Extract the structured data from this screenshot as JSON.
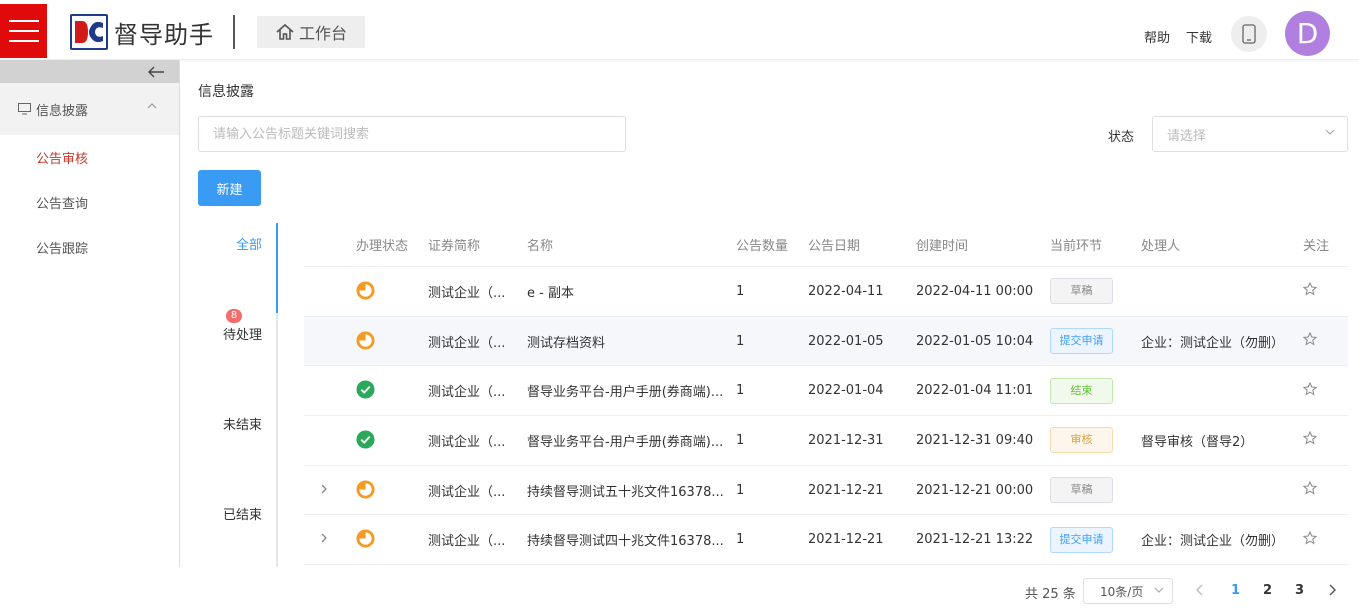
{
  "header": {
    "logo_mark": "DC",
    "logo_text": "督导助手",
    "workbench_label": "工作台",
    "help_label": "帮助",
    "download_label": "下载",
    "avatar_letter": "D",
    "brand_color": "#e10a0a",
    "avatar_color": "#b07fe0"
  },
  "sidebar": {
    "group_label": "信息披露",
    "items": [
      {
        "label": "公告审核",
        "active": true
      },
      {
        "label": "公告查询",
        "active": false
      },
      {
        "label": "公告跟踪",
        "active": false
      }
    ]
  },
  "main": {
    "title": "信息披露",
    "search_placeholder": "请输入公告标题关键词搜索",
    "status_label": "状态",
    "status_placeholder": "请选择",
    "new_button": "新建",
    "accent_color": "#3a9bf4"
  },
  "tabs": [
    {
      "label": "全部",
      "active": true
    },
    {
      "label": "待处理",
      "badge": "8"
    },
    {
      "label": "未结束"
    },
    {
      "label": "已结束"
    }
  ],
  "table": {
    "columns": [
      "办理状态",
      "证券简称",
      "名称",
      "公告数量",
      "公告日期",
      "创建时间",
      "当前环节",
      "处理人",
      "关注"
    ],
    "rows": [
      {
        "expand": false,
        "status_icon": "pending",
        "security": "测试企业（...",
        "name": "e - 副本",
        "count": "1",
        "pub_date": "2022-04-11",
        "created": "2022-04-11 00:00",
        "stage": "草稿",
        "stage_type": "draft",
        "handler": "",
        "highlight": false
      },
      {
        "expand": false,
        "status_icon": "pending",
        "security": "测试企业（...",
        "name": "测试存档资料",
        "count": "1",
        "pub_date": "2022-01-05",
        "created": "2022-01-05 10:04",
        "stage": "提交申请",
        "stage_type": "submit",
        "handler": "企业：测试企业（勿删）",
        "highlight": true
      },
      {
        "expand": false,
        "status_icon": "done",
        "security": "测试企业（...",
        "name": "督导业务平台-用户手册(券商端)...",
        "count": "1",
        "pub_date": "2022-01-04",
        "created": "2022-01-04 11:01",
        "stage": "结束",
        "stage_type": "done",
        "handler": "",
        "highlight": false
      },
      {
        "expand": false,
        "status_icon": "done",
        "security": "测试企业（...",
        "name": "督导业务平台-用户手册(券商端)...",
        "count": "1",
        "pub_date": "2021-12-31",
        "created": "2021-12-31 09:40",
        "stage": "审核",
        "stage_type": "review",
        "handler": "督导审核（督导2）",
        "highlight": false
      },
      {
        "expand": true,
        "status_icon": "pending",
        "security": "测试企业（...",
        "name": "持续督导测试五十兆文件16378...",
        "count": "1",
        "pub_date": "2021-12-21",
        "created": "2021-12-21 00:00",
        "stage": "草稿",
        "stage_type": "draft",
        "handler": "",
        "highlight": false
      },
      {
        "expand": true,
        "status_icon": "pending",
        "security": "测试企业（...",
        "name": "持续督导测试四十兆文件16378...",
        "count": "1",
        "pub_date": "2021-12-21",
        "created": "2021-12-21 13:22",
        "stage": "提交申请",
        "stage_type": "submit",
        "handler": "企业：测试企业（勿删）",
        "highlight": false
      }
    ]
  },
  "pagination": {
    "total": "共 25 条",
    "page_size": "10条/页",
    "pages": [
      "1",
      "2",
      "3"
    ],
    "current": "1"
  },
  "icons": {
    "pending_color": "#f59a23",
    "done_color": "#2ca85a"
  }
}
